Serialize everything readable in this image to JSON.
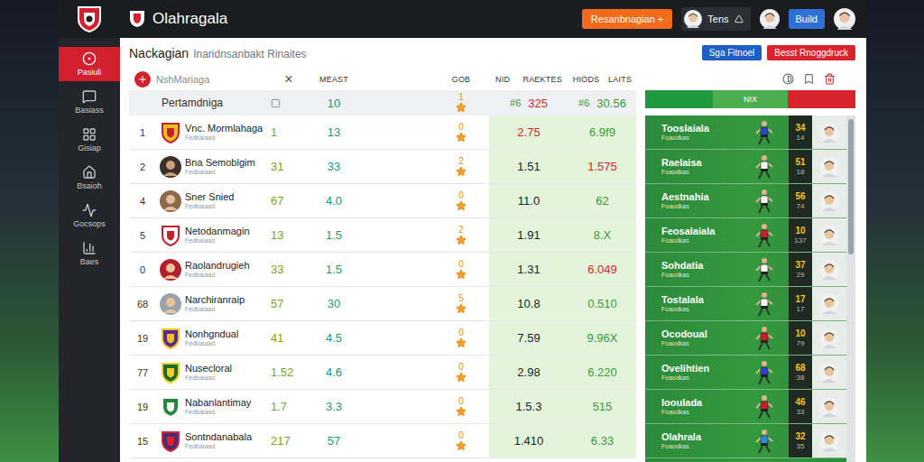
{
  "window": {
    "title": "Olahragala"
  },
  "topbar": {
    "action_button": "Resanbnagian +",
    "user_name": "Tens",
    "build_button": "Build"
  },
  "sidebar": {
    "items": [
      {
        "label": "Pasiuli",
        "selected": true
      },
      {
        "label": "Basiass",
        "selected": false
      },
      {
        "label": "Gisiap",
        "selected": false
      },
      {
        "label": "Bsaioh",
        "selected": false
      },
      {
        "label": "Gocsops",
        "selected": false
      },
      {
        "label": "Baes",
        "selected": false
      }
    ]
  },
  "page": {
    "title": "Nackagian",
    "subtitle": "Inaridnsanbakt Rinaites",
    "buttons": [
      {
        "label": "Sga Fitnoel",
        "color": "#1f5fc4"
      },
      {
        "label": "Besst Rnoggdruck",
        "color": "#d9232d"
      }
    ]
  },
  "search": {
    "placeholder": "NshMariaga",
    "clear": "×"
  },
  "table": {
    "columns": [
      {
        "labels": [
          "MEAST"
        ]
      },
      {
        "labels": [
          "GOB"
        ]
      },
      {
        "labels": [
          "NID",
          "RAEKTES"
        ]
      },
      {
        "labels": [
          "HIODS",
          "LAITS"
        ]
      }
    ],
    "summary": {
      "label": "Pertamdniga",
      "pts": "10",
      "star": "1",
      "a_tag": "#6",
      "a": "325",
      "b_tag": "#6",
      "b": "30.56"
    },
    "rows": [
      {
        "rank": "1",
        "name": "Vnc. Mormlahaga",
        "sub": "Fedbaiaad",
        "logo": "shield",
        "color": "#e8c21c",
        "accent": "#c8202a",
        "gob": "1",
        "pts": "13",
        "star": "0",
        "rating": "2.75",
        "rating_down": true,
        "form": "6.9f9",
        "form_down": false
      },
      {
        "rank": "2",
        "name": "Bna Semoblgim",
        "sub": "Fedbaiaad",
        "logo": "avatar",
        "color": "#3b2f2a",
        "accent": "#c9a27c",
        "gob": "31",
        "pts": "33",
        "star": "2",
        "rating": "1.51",
        "rating_down": false,
        "form": "1.575",
        "form_down": true
      },
      {
        "rank": "4",
        "name": "Sner Snied",
        "sub": "Fedbaiaad",
        "logo": "avatar",
        "color": "#8a6a4a",
        "accent": "#e3c09a",
        "gob": "67",
        "pts": "4.0",
        "star": "0",
        "rating": "11.0",
        "rating_down": false,
        "form": "62",
        "form_down": false
      },
      {
        "rank": "5",
        "name": "Netodanmagin",
        "sub": "Fedbaiaad",
        "logo": "shield",
        "color": "#ffffff",
        "accent": "#c8202a",
        "gob": "13",
        "pts": "1.5",
        "star": "2",
        "rating": "1.91",
        "rating_down": false,
        "form": "8.X",
        "form_down": false
      },
      {
        "rank": "0",
        "name": "Raolandrugieh",
        "sub": "Fedbaiaad",
        "logo": "avatar",
        "color": "#b3202a",
        "accent": "#e9c29f",
        "gob": "33",
        "pts": "1.5",
        "star": "0",
        "rating": "1.31",
        "rating_down": false,
        "form": "6.049",
        "form_down": true
      },
      {
        "rank": "68",
        "name": "Narchiranraip",
        "sub": "Fedbaiaad",
        "logo": "avatar",
        "color": "#9aa3ab",
        "accent": "#e9c29f",
        "gob": "57",
        "pts": "30",
        "star": "5",
        "rating": "10.8",
        "rating_down": false,
        "form": "0.510",
        "form_down": false
      },
      {
        "rank": "19",
        "name": "Nonhgndual",
        "sub": "Fedbaiaad",
        "logo": "shield",
        "color": "#5a2a8a",
        "accent": "#f0c020",
        "gob": "41",
        "pts": "4.5",
        "star": "0",
        "rating": "7.59",
        "rating_down": false,
        "form": "9.96X",
        "form_down": false
      },
      {
        "rank": "77",
        "name": "Nusecloral",
        "sub": "Fedbaiaad",
        "logo": "shield",
        "color": "#1d6b2a",
        "accent": "#f0d020",
        "gob": "1.52",
        "pts": "4.6",
        "star": "0",
        "rating": "2.98",
        "rating_down": false,
        "form": "6.220",
        "form_down": false
      },
      {
        "rank": "19",
        "name": "Nabanlantimay",
        "sub": "Fedbaiaad",
        "logo": "shield",
        "color": "#1f8a3a",
        "accent": "#ffffff",
        "gob": "1.7",
        "pts": "3.3",
        "star": "0",
        "rating": "1.5.3",
        "rating_down": false,
        "form": "515",
        "form_down": false
      },
      {
        "rank": "15",
        "name": "Sontndanabala",
        "sub": "Fedbaiaad",
        "logo": "shield",
        "color": "#4a2a7a",
        "accent": "#d9232d",
        "gob": "217",
        "pts": "57",
        "star": "0",
        "rating": "1.410",
        "rating_down": false,
        "form": "6.33",
        "form_down": false
      }
    ]
  },
  "lineup": {
    "label": "NIX",
    "bar": [
      {
        "level": 0.32,
        "color": "#1e9a3c",
        "labeled": false
      },
      {
        "level": 0.36,
        "color": "#4cae4f",
        "labeled": true
      },
      {
        "level": 0.32,
        "color": "#d9232d",
        "labeled": false
      }
    ],
    "players": [
      {
        "name": "Tooslaiala",
        "sub": "Foaodkas",
        "number": "34",
        "sub_number": "14",
        "color": "#2a46c8"
      },
      {
        "name": "Raelaisa",
        "sub": "Foaodkas",
        "number": "51",
        "sub_number": "18",
        "color": "#f4f4f4"
      },
      {
        "name": "Aestnahia",
        "sub": "Foaodkas",
        "number": "56",
        "sub_number": "74",
        "color": "#f4f4f4"
      },
      {
        "name": "Feosalaiala",
        "sub": "Foaodkas",
        "number": "10",
        "sub_number": "137",
        "color": "#c8202a"
      },
      {
        "name": "Sohdatia",
        "sub": "Foaodkas",
        "number": "37",
        "sub_number": "29",
        "color": "#f4f4f4"
      },
      {
        "name": "Tostalala",
        "sub": "Foaodkas",
        "number": "17",
        "sub_number": "17",
        "color": "#f4f4f4"
      },
      {
        "name": "Ocodoual",
        "sub": "Foaodkas",
        "number": "10",
        "sub_number": "79",
        "color": "#c8202a"
      },
      {
        "name": "Ovelihtien",
        "sub": "Foaodkas",
        "number": "68",
        "sub_number": "38",
        "color": "#2a46c8"
      },
      {
        "name": "Iooulada",
        "sub": "Foaodkas",
        "number": "46",
        "sub_number": "33",
        "color": "#c8202a"
      },
      {
        "name": "Olahrala",
        "sub": "Foaodkas",
        "number": "32",
        "sub_number": "35",
        "color": "#2a8ad8"
      }
    ]
  }
}
